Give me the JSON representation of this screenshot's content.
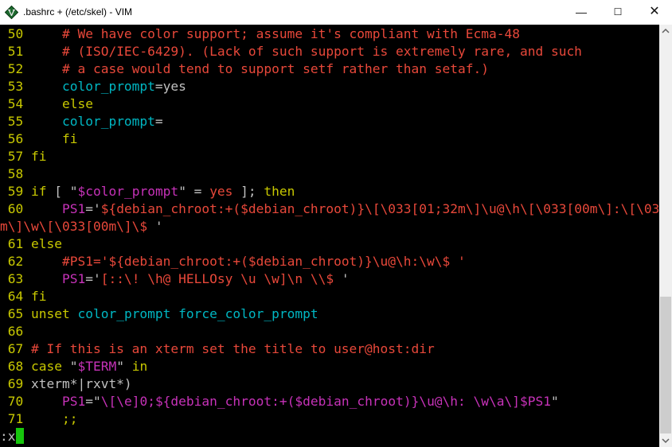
{
  "window": {
    "title": ".bashrc + (/etc/skel) - VIM",
    "app_icon": "vim-icon",
    "controls": {
      "minimize": "—",
      "maximize": "☐",
      "close": "✕"
    }
  },
  "colors": {
    "background": "#000000",
    "line_number": "#c8c800",
    "comment": "#e8483a",
    "keyword": "#c8c800",
    "variable": "#00b7c3",
    "special": "#c732b9",
    "plain": "#c0c0c0",
    "cursor": "#16c60c"
  },
  "editor": {
    "lines": [
      {
        "num": "50",
        "segments": [
          {
            "t": "    ",
            "c": "plain"
          },
          {
            "t": "# We have color support; assume it's compliant with Ecma-48",
            "c": "comment"
          }
        ]
      },
      {
        "num": "51",
        "segments": [
          {
            "t": "    ",
            "c": "plain"
          },
          {
            "t": "# (ISO/IEC-6429). (Lack of such support is extremely rare, and such",
            "c": "comment"
          }
        ]
      },
      {
        "num": "52",
        "segments": [
          {
            "t": "    ",
            "c": "plain"
          },
          {
            "t": "# a case would tend to support setf rather than setaf.)",
            "c": "comment"
          }
        ]
      },
      {
        "num": "53",
        "segments": [
          {
            "t": "    ",
            "c": "plain"
          },
          {
            "t": "color_prompt",
            "c": "var"
          },
          {
            "t": "=yes",
            "c": "plain"
          }
        ]
      },
      {
        "num": "54",
        "segments": [
          {
            "t": "    ",
            "c": "plain"
          },
          {
            "t": "else",
            "c": "kw"
          }
        ]
      },
      {
        "num": "55",
        "segments": [
          {
            "t": "    ",
            "c": "plain"
          },
          {
            "t": "color_prompt",
            "c": "var"
          },
          {
            "t": "=",
            "c": "plain"
          }
        ]
      },
      {
        "num": "56",
        "segments": [
          {
            "t": "    ",
            "c": "plain"
          },
          {
            "t": "fi",
            "c": "kw"
          }
        ]
      },
      {
        "num": "57",
        "segments": [
          {
            "t": "fi",
            "c": "kw"
          }
        ]
      },
      {
        "num": "58",
        "segments": []
      },
      {
        "num": "59",
        "segments": [
          {
            "t": "if",
            "c": "kw"
          },
          {
            "t": " [ ",
            "c": "plain"
          },
          {
            "t": "\"",
            "c": "plain"
          },
          {
            "t": "$color_prompt",
            "c": "special"
          },
          {
            "t": "\"",
            "c": "plain"
          },
          {
            "t": " = ",
            "c": "plain"
          },
          {
            "t": "yes",
            "c": "str"
          },
          {
            "t": " ]; ",
            "c": "plain"
          },
          {
            "t": "then",
            "c": "kw"
          }
        ]
      },
      {
        "num": "60",
        "segments": [
          {
            "t": "    ",
            "c": "plain"
          },
          {
            "t": "PS1",
            "c": "special"
          },
          {
            "t": "=",
            "c": "plain"
          },
          {
            "t": "'",
            "c": "plain"
          },
          {
            "t": "${debian_chroot:+($debian_chroot)}\\[\\033[01;32m\\]\\u@\\h\\[\\033[00m\\]:\\[\\033[01;34",
            "c": "str"
          }
        ]
      },
      {
        "num": "",
        "segments": [
          {
            "t": "m\\]\\w\\[\\033[00m\\]\\$ ",
            "c": "str"
          },
          {
            "t": "'",
            "c": "plain"
          }
        ]
      },
      {
        "num": "61",
        "segments": [
          {
            "t": "else",
            "c": "kw"
          }
        ]
      },
      {
        "num": "62",
        "segments": [
          {
            "t": "    ",
            "c": "plain"
          },
          {
            "t": "#PS1='${debian_chroot:+($debian_chroot)}\\u@\\h:\\w\\$ '",
            "c": "comment"
          }
        ]
      },
      {
        "num": "63",
        "segments": [
          {
            "t": "    ",
            "c": "plain"
          },
          {
            "t": "PS1",
            "c": "special"
          },
          {
            "t": "=",
            "c": "plain"
          },
          {
            "t": "'",
            "c": "plain"
          },
          {
            "t": "[::\\! \\h@ HELLOsy \\u \\w]\\n \\\\$ ",
            "c": "str"
          },
          {
            "t": "'",
            "c": "plain"
          }
        ]
      },
      {
        "num": "64",
        "segments": [
          {
            "t": "fi",
            "c": "kw"
          }
        ]
      },
      {
        "num": "65",
        "segments": [
          {
            "t": "unset",
            "c": "kw"
          },
          {
            "t": " ",
            "c": "plain"
          },
          {
            "t": "color_prompt force_color_prompt",
            "c": "var"
          }
        ]
      },
      {
        "num": "66",
        "segments": []
      },
      {
        "num": "67",
        "segments": [
          {
            "t": "# If this is an xterm set the title to user@host:dir",
            "c": "comment"
          }
        ]
      },
      {
        "num": "68",
        "segments": [
          {
            "t": "case",
            "c": "kw"
          },
          {
            "t": " ",
            "c": "plain"
          },
          {
            "t": "\"",
            "c": "plain"
          },
          {
            "t": "$TERM",
            "c": "special"
          },
          {
            "t": "\"",
            "c": "plain"
          },
          {
            "t": " ",
            "c": "plain"
          },
          {
            "t": "in",
            "c": "kw"
          }
        ]
      },
      {
        "num": "69",
        "segments": [
          {
            "t": "xterm*|rxvt*)",
            "c": "plain"
          }
        ]
      },
      {
        "num": "70",
        "segments": [
          {
            "t": "    ",
            "c": "plain"
          },
          {
            "t": "PS1",
            "c": "special"
          },
          {
            "t": "=",
            "c": "plain"
          },
          {
            "t": "\"",
            "c": "plain"
          },
          {
            "t": "\\[\\e]0;${debian_chroot:+(",
            "c": "special"
          },
          {
            "t": "$debian_chroot",
            "c": "special"
          },
          {
            "t": ")}\\u@\\h: \\w\\a\\]",
            "c": "special"
          },
          {
            "t": "$PS1",
            "c": "special"
          },
          {
            "t": "\"",
            "c": "plain"
          }
        ]
      },
      {
        "num": "71",
        "segments": [
          {
            "t": "    ",
            "c": "plain"
          },
          {
            "t": ";;",
            "c": "kw"
          }
        ]
      }
    ],
    "command_line": ":x"
  }
}
